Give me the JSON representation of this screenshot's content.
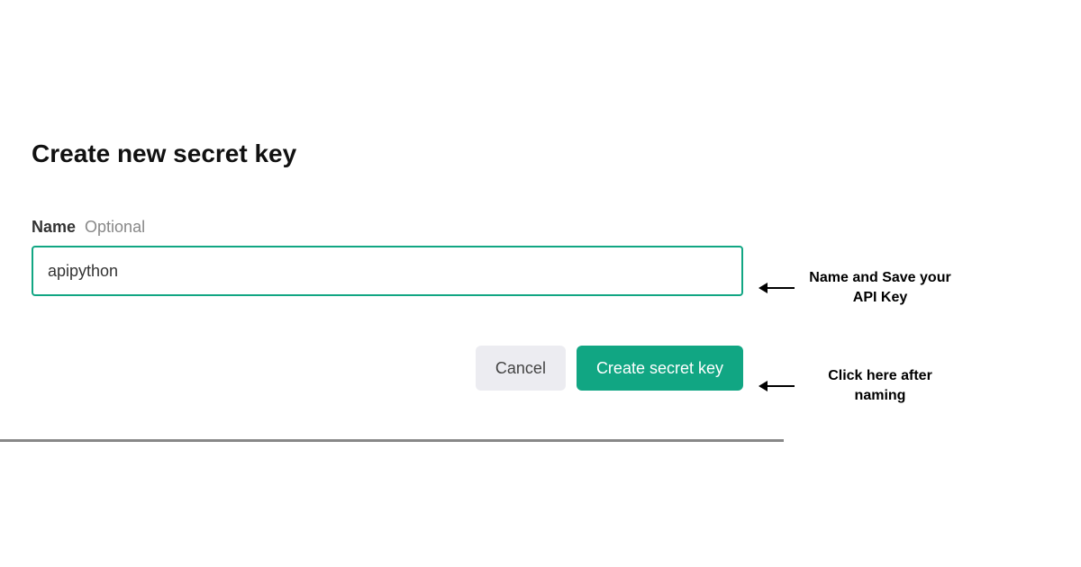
{
  "dialog": {
    "title": "Create new secret key",
    "name_label": "Name",
    "name_hint": "Optional",
    "name_value": "apipython",
    "cancel_label": "Cancel",
    "create_label": "Create secret key"
  },
  "annotations": {
    "input": "Name and Save your API Key",
    "button": "Click here after naming"
  },
  "colors": {
    "accent": "#11a683"
  }
}
